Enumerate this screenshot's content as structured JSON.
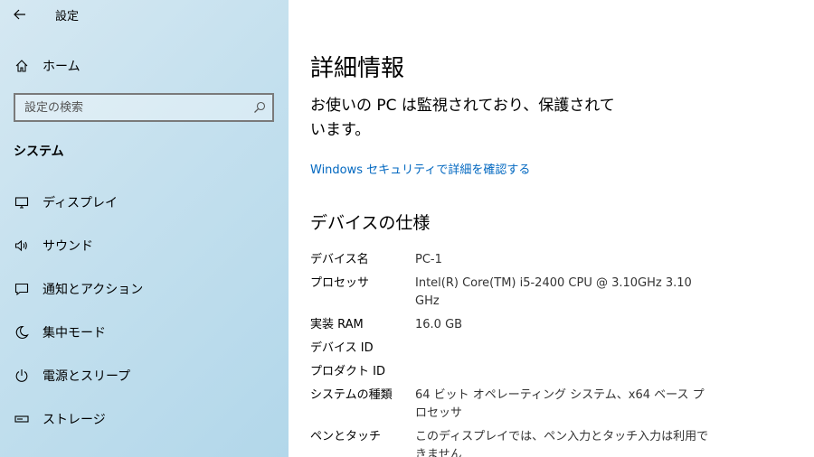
{
  "window": {
    "title": "設定"
  },
  "sidebar": {
    "home_label": "ホーム",
    "search": {
      "placeholder": "設定の検索",
      "value": ""
    },
    "section_heading": "システム",
    "items": [
      {
        "label": "ディスプレイ",
        "icon": "display-icon"
      },
      {
        "label": "サウンド",
        "icon": "speaker-icon"
      },
      {
        "label": "通知とアクション",
        "icon": "notification-icon"
      },
      {
        "label": "集中モード",
        "icon": "moon-icon"
      },
      {
        "label": "電源とスリープ",
        "icon": "power-icon"
      },
      {
        "label": "ストレージ",
        "icon": "storage-icon"
      }
    ]
  },
  "main": {
    "title": "詳細情報",
    "protection_message": "お使いの PC は監視されており、保護されています。",
    "security_link": "Windows セキュリティで詳細を確認する",
    "spec_heading": "デバイスの仕様",
    "specs": [
      {
        "label": "デバイス名",
        "value": "PC-1"
      },
      {
        "label": "プロセッサ",
        "value": "Intel(R) Core(TM) i5-2400 CPU @ 3.10GHz   3.10 GHz"
      },
      {
        "label": "実装 RAM",
        "value": "16.0 GB"
      },
      {
        "label": "デバイス ID",
        "value": ""
      },
      {
        "label": "プロダクト ID",
        "value": ""
      },
      {
        "label": "システムの種類",
        "value": "64 ビット オペレーティング システム、x64 ベース プロセッサ"
      },
      {
        "label": "ペンとタッチ",
        "value": "このディスプレイでは、ペン入力とタッチ入力は利用できません"
      }
    ]
  },
  "colors": {
    "accent_link": "#0067c0",
    "sidebar_bg": "#c4e0ee"
  }
}
